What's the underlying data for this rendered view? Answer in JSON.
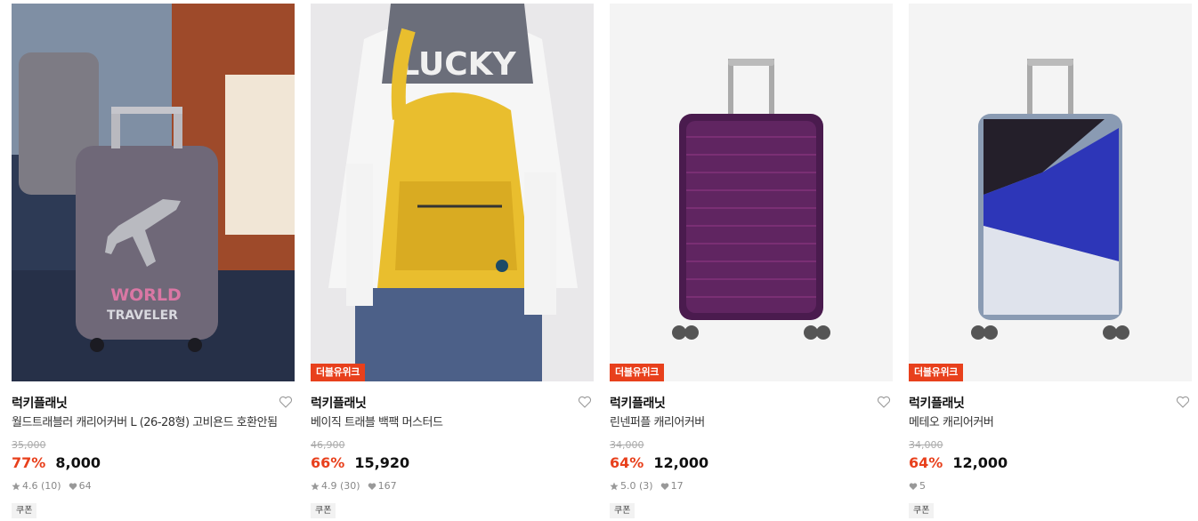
{
  "products": [
    {
      "badge": "",
      "brand": "럭키플래닛",
      "name": "월드트래블러 캐리어커버 L (26-28형) 고비욘드 호환안됨",
      "original_price": "35,000",
      "discount": "77%",
      "price": "8,000",
      "rating": "4.6 (10)",
      "likes": "64",
      "coupon": "쿠폰",
      "image_text_line1": "WORLD",
      "image_text_line2": "TRAVELER"
    },
    {
      "badge": "더블유위크",
      "brand": "럭키플래닛",
      "name": "베이직 트래블 백팩 머스터드",
      "original_price": "46,900",
      "discount": "66%",
      "price": "15,920",
      "rating": "4.9 (30)",
      "likes": "167",
      "coupon": "쿠폰",
      "image_text_line1": "LUCKY"
    },
    {
      "badge": "더블유위크",
      "brand": "럭키플래닛",
      "name": "린넨퍼플 캐리어커버",
      "original_price": "34,000",
      "discount": "64%",
      "price": "12,000",
      "rating": "5.0 (3)",
      "likes": "17",
      "coupon": "쿠폰"
    },
    {
      "badge": "더블유위크",
      "brand": "럭키플래닛",
      "name": "메테오 캐리어커버",
      "original_price": "34,000",
      "discount": "64%",
      "price": "12,000",
      "rating": "",
      "likes": "5",
      "coupon": "쿠폰"
    }
  ],
  "colors": {
    "accent": "#e8401c",
    "strike": "#aaaaaa",
    "meta": "#888888"
  },
  "icons": {
    "wishlist": "heart-outline-icon",
    "rating": "star-icon",
    "likes": "heart-filled-icon"
  }
}
